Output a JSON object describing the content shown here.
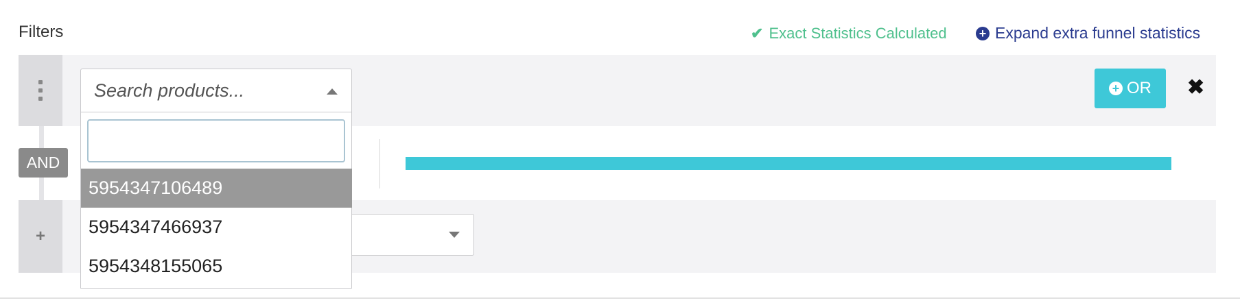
{
  "header": {
    "title": "Filters",
    "status_text": "Exact Statistics Calculated",
    "expand_link": "Expand extra funnel statistics"
  },
  "filter": {
    "search_placeholder": "Search products...",
    "or_button_label": "OR",
    "close_symbol": "✖",
    "and_label": "AND",
    "dropdown_search_value": "",
    "options": [
      "5954347106489",
      "5954347466937",
      "5954348155065"
    ],
    "highlighted_option": "5954347106489"
  },
  "icons": {
    "status": "check-icon",
    "expand": "plus-circle-icon",
    "or": "plus-circle-icon",
    "close": "close-icon",
    "handle": "drag-handle-icon",
    "add": "plus-icon",
    "search_caret": "caret-up-icon",
    "second_caret": "caret-down-icon"
  },
  "colors": {
    "accent": "#3ec8d8",
    "link": "#2a3b8f",
    "success": "#4fc08d",
    "badge": "#8a8a8a",
    "highlight": "#999999"
  }
}
